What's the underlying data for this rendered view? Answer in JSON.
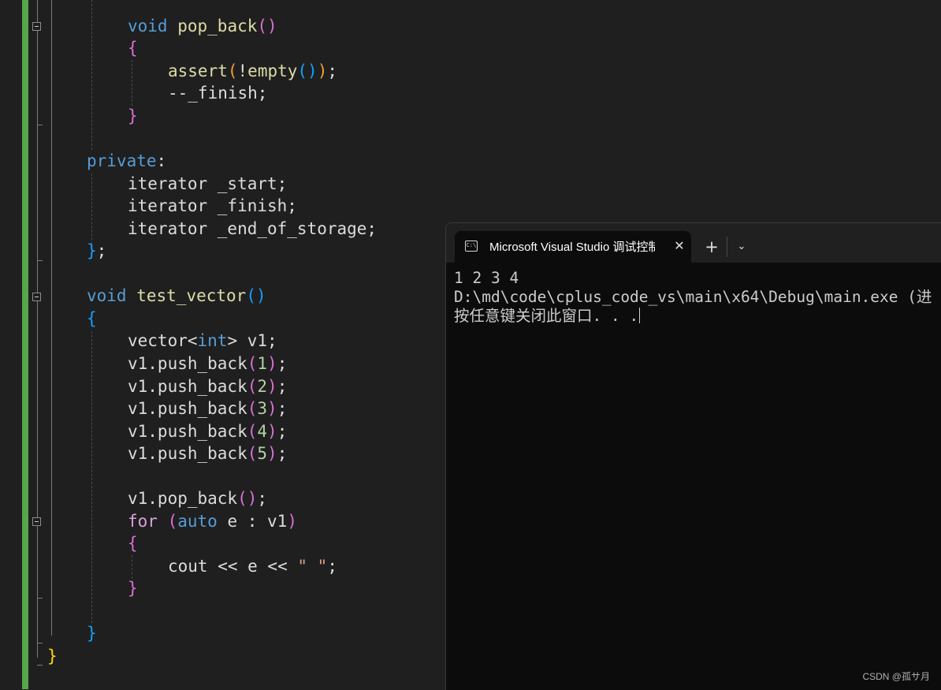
{
  "editor": {
    "lines": [
      [
        {
          "t": "void",
          "c": "kw"
        },
        {
          "t": " ",
          "c": "pl"
        },
        {
          "t": "pop_back",
          "c": "fn"
        },
        {
          "t": "()",
          "c": "b2"
        }
      ],
      [
        {
          "t": "{",
          "c": "b2"
        }
      ],
      [
        {
          "t": "assert",
          "c": "fn"
        },
        {
          "t": "(",
          "c": "bo"
        },
        {
          "t": "!",
          "c": "pl"
        },
        {
          "t": "empty",
          "c": "fn"
        },
        {
          "t": "()",
          "c": "b3"
        },
        {
          "t": ")",
          "c": "bo"
        },
        {
          "t": ";",
          "c": "pl"
        }
      ],
      [
        {
          "t": "--_finish;",
          "c": "pl"
        }
      ],
      [
        {
          "t": "}",
          "c": "b2"
        }
      ],
      [],
      [
        {
          "t": "private",
          "c": "kw"
        },
        {
          "t": ":",
          "c": "pl"
        }
      ],
      [
        {
          "t": "iterator _start;",
          "c": "pl"
        }
      ],
      [
        {
          "t": "iterator _finish;",
          "c": "pl"
        }
      ],
      [
        {
          "t": "iterator _end_of_storage;",
          "c": "pl"
        }
      ],
      [
        {
          "t": "}",
          "c": "b3"
        },
        {
          "t": ";",
          "c": "pl"
        }
      ],
      [],
      [
        {
          "t": "void",
          "c": "kw"
        },
        {
          "t": " ",
          "c": "pl"
        },
        {
          "t": "test_vector",
          "c": "fn"
        },
        {
          "t": "()",
          "c": "b3"
        }
      ],
      [
        {
          "t": "{",
          "c": "b3"
        }
      ],
      [
        {
          "t": "vector<",
          "c": "pl"
        },
        {
          "t": "int",
          "c": "kw"
        },
        {
          "t": "> v1;",
          "c": "pl"
        }
      ],
      [
        {
          "t": "v1.push_back",
          "c": "pl"
        },
        {
          "t": "(",
          "c": "b2"
        },
        {
          "t": "1",
          "c": "num"
        },
        {
          "t": ")",
          "c": "b2"
        },
        {
          "t": ";",
          "c": "pl"
        }
      ],
      [
        {
          "t": "v1.push_back",
          "c": "pl"
        },
        {
          "t": "(",
          "c": "b2"
        },
        {
          "t": "2",
          "c": "num"
        },
        {
          "t": ")",
          "c": "b2"
        },
        {
          "t": ";",
          "c": "pl"
        }
      ],
      [
        {
          "t": "v1.push_back",
          "c": "pl"
        },
        {
          "t": "(",
          "c": "b2"
        },
        {
          "t": "3",
          "c": "num"
        },
        {
          "t": ")",
          "c": "b2"
        },
        {
          "t": ";",
          "c": "pl"
        }
      ],
      [
        {
          "t": "v1.push_back",
          "c": "pl"
        },
        {
          "t": "(",
          "c": "b2"
        },
        {
          "t": "4",
          "c": "num"
        },
        {
          "t": ")",
          "c": "b2"
        },
        {
          "t": ";",
          "c": "pl"
        }
      ],
      [
        {
          "t": "v1.push_back",
          "c": "pl"
        },
        {
          "t": "(",
          "c": "b2"
        },
        {
          "t": "5",
          "c": "num"
        },
        {
          "t": ")",
          "c": "b2"
        },
        {
          "t": ";",
          "c": "pl"
        }
      ],
      [],
      [
        {
          "t": "v1.pop_back",
          "c": "pl"
        },
        {
          "t": "()",
          "c": "b2"
        },
        {
          "t": ";",
          "c": "pl"
        }
      ],
      [
        {
          "t": "for",
          "c": "ctl"
        },
        {
          "t": " ",
          "c": "pl"
        },
        {
          "t": "(",
          "c": "b2"
        },
        {
          "t": "auto",
          "c": "kw"
        },
        {
          "t": " e : v1",
          "c": "pl"
        },
        {
          "t": ")",
          "c": "b2"
        }
      ],
      [
        {
          "t": "{",
          "c": "b2"
        }
      ],
      [
        {
          "t": "cout << e << ",
          "c": "pl"
        },
        {
          "t": "\" \"",
          "c": "str"
        },
        {
          "t": ";",
          "c": "pl"
        }
      ],
      [
        {
          "t": "}",
          "c": "b2"
        }
      ],
      [],
      [
        {
          "t": "}",
          "c": "b3"
        }
      ],
      [
        {
          "t": "}",
          "c": "b1"
        }
      ]
    ],
    "colors": {
      "change_bar": "#57a64a",
      "background": "#1f1f1f",
      "keyword": "#569cd6",
      "function": "#dcdcaa"
    }
  },
  "terminal": {
    "tab_icon_text": "C:\\",
    "tab_title": "Microsoft Visual Studio 调试控制台",
    "close_glyph": "✕",
    "new_tab_glyph": "+",
    "dropdown_glyph": "⌄",
    "output": [
      "1 2 3 4",
      "D:\\md\\code\\cplus_code_vs\\main\\x64\\Debug\\main.exe (进",
      "按任意键关闭此窗口. . ."
    ]
  },
  "watermark": "CSDN @孤サ月"
}
